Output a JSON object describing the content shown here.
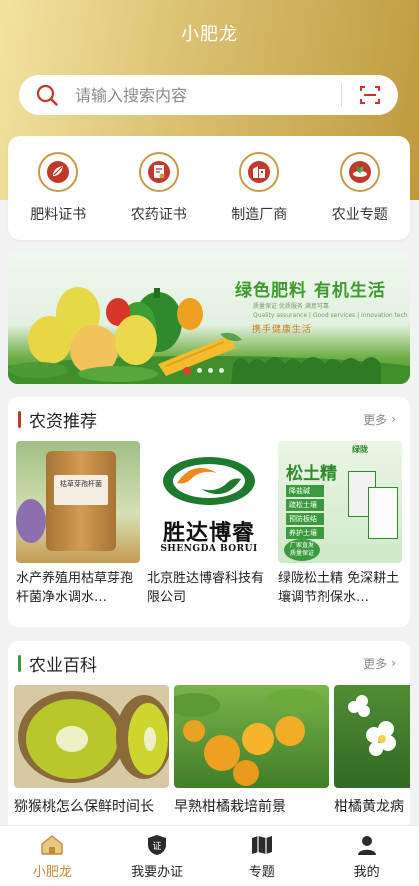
{
  "app": {
    "title": "小肥龙"
  },
  "search": {
    "placeholder": "请输入搜索内容"
  },
  "quick_links": [
    {
      "label": "肥料证书",
      "icon": "leaf-certificate-icon"
    },
    {
      "label": "农药证书",
      "icon": "pesticide-certificate-icon"
    },
    {
      "label": "制造厂商",
      "icon": "factory-icon"
    },
    {
      "label": "农业专题",
      "icon": "agriculture-topic-icon"
    }
  ],
  "banner": {
    "headline": "绿色肥料 有机生活",
    "sub_line1": "质量保证  优质服务  满意可靠",
    "sub_line2": "Quality assurance | Good services | innovation tech",
    "slogan": "携手健康生活",
    "slide_count": 4,
    "active_slide": 1
  },
  "recommend": {
    "title": "农资推荐",
    "more_label": "更多",
    "items": [
      {
        "text": "水产养殖用枯草芽孢杆菌净水调水…",
        "img_label": "枯草芽孢杆菌"
      },
      {
        "text": "北京胜达博睿科技有限公司",
        "logo_cn": "胜达博睿",
        "logo_en": "SHENGDA BORUI"
      },
      {
        "text": "绿陇松土精 免深耕土壤调节剂保水…",
        "img_title": "松土精",
        "brand": "绿陇",
        "tags": [
          "降盐碱",
          "疏松土壤",
          "预防板结",
          "养护土壤"
        ],
        "badge": "厂家直发 质量保证"
      }
    ]
  },
  "encyclopedia": {
    "title": "农业百科",
    "more_label": "更多",
    "items": [
      {
        "text": "猕猴桃怎么保鲜时间长"
      },
      {
        "text": "早熟柑橘栽培前景"
      },
      {
        "text": "柑橘黄龙病"
      }
    ]
  },
  "tabbar": [
    {
      "label": "小肥龙",
      "icon": "home-icon",
      "active": true
    },
    {
      "label": "我要办证",
      "icon": "certificate-icon",
      "active": false
    },
    {
      "label": "专题",
      "icon": "map-icon",
      "active": false
    },
    {
      "label": "我的",
      "icon": "user-icon",
      "active": false
    }
  ],
  "colors": {
    "accent": "#c08b3b",
    "section_bar_red": "#c0392b",
    "section_bar_green": "#3a9a3e",
    "header_gold": "#c9a24a"
  }
}
